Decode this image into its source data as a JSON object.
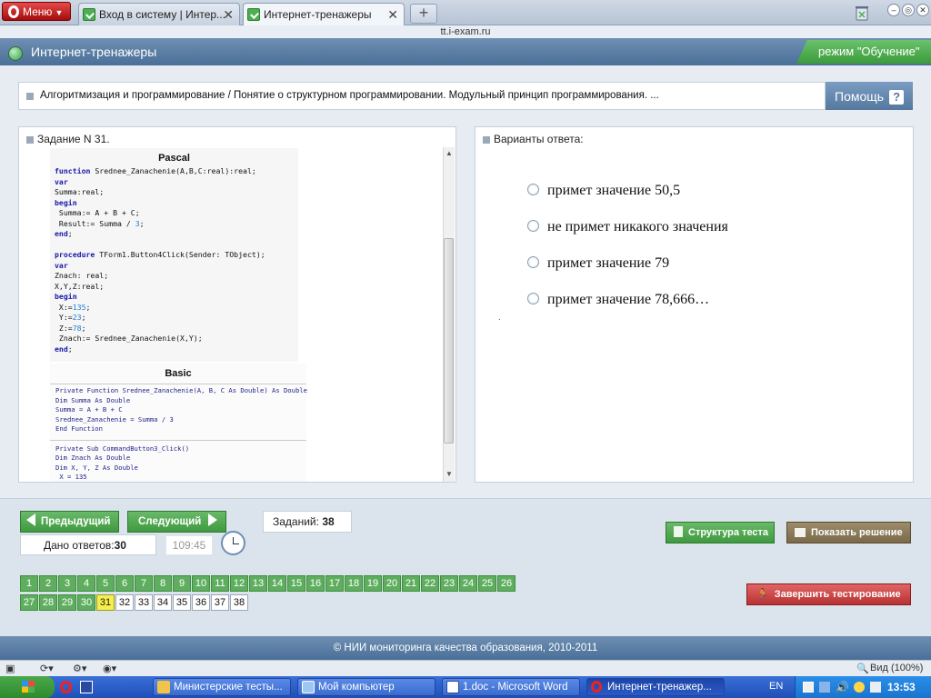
{
  "browser": {
    "menu_label": "Меню",
    "tabs": [
      {
        "label": "Вход в систему | Интер...",
        "active": false
      },
      {
        "label": "Интернет-тренажеры",
        "active": true
      }
    ],
    "address": "tt.i-exam.ru",
    "zoom": "Вид (100%)"
  },
  "site": {
    "title": "Интернет-тренажеры",
    "mode": "режим \"Обучение\"",
    "breadcrumb": "Алгоритмизация и программирование / Понятие о структурном программировании. Модульный принцип программирования. ...",
    "help_label": "Помощь",
    "help_icon": "?"
  },
  "task": {
    "title": "Задание N 31.",
    "pascal_heading": "Pascal",
    "basic_heading": "Basic",
    "pascal_code": [
      "function Srednee_Zanachenie(A,B,C:real):real;",
      "var",
      "Summa:real;",
      "begin",
      " Summa:= A + B + C;",
      " Result:= Summa / 3;",
      "end;",
      "",
      "procedure TForm1.Button4Click(Sender: TObject);",
      "var",
      "Znach: real;",
      "X,Y,Z:real;",
      "begin",
      " X:=135;",
      " Y:=23;",
      " Z:=78;",
      " Znach:= Srednee_Zanachenie(X,Y);",
      "end;"
    ],
    "basic_code_1": [
      "Private Function Srednee_Zanachenie(A, B, C As Double) As Double",
      "Dim Summa As Double",
      "Summa = A + B + C",
      "Srednee_Zanachenie = Summa / 3",
      "End Function"
    ],
    "basic_code_2": [
      "Private Sub CommandButton3_Click()",
      "Dim Znach As Double",
      "Dim X, Y, Z As Double",
      " X = 135"
    ]
  },
  "answers": {
    "title": "Варианты ответа:",
    "options": [
      "примет значение 50,5",
      "не примет никакого значения",
      "примет значение 79",
      "примет значение 78,666…"
    ],
    "dot": "."
  },
  "controls": {
    "prev_label": "Предыдущий",
    "next_label": "Следующий",
    "tasks_label": "Заданий:",
    "tasks_count": "38",
    "answers_label": "Дано ответов:",
    "answers_count": "30",
    "timer": "109:45",
    "structure_label": "Структура теста",
    "show_solution_label": "Показать решение",
    "finish_label": "Завершить тестирование"
  },
  "questions": {
    "done": [
      "1",
      "2",
      "3",
      "4",
      "5",
      "6",
      "7",
      "8",
      "9",
      "10",
      "11",
      "12",
      "13",
      "14",
      "15",
      "16",
      "17",
      "18",
      "19",
      "20",
      "21",
      "22",
      "23",
      "24",
      "25",
      "26",
      "27",
      "28",
      "29",
      "30"
    ],
    "current": "31",
    "todo": [
      "32",
      "33",
      "34",
      "35",
      "36",
      "37",
      "38"
    ]
  },
  "footer": "© НИИ мониторинга качества образования, 2010-2011",
  "taskbar": {
    "items": [
      {
        "label": "Министерские тесты...",
        "icon": "folder-icon"
      },
      {
        "label": "Мой компьютер",
        "icon": "computer-icon"
      },
      {
        "label": "1.doc - Microsoft Word",
        "icon": "word-icon"
      },
      {
        "label": "Интернет-тренажер...",
        "icon": "opera-icon"
      }
    ],
    "lang": "EN",
    "time": "13:53"
  },
  "colors": {
    "header_blue": "#4a6f98",
    "green": "#3f9a3f",
    "brown": "#8a7a5a",
    "red": "#c83a3a",
    "current_yellow": "#f6ee4a"
  }
}
